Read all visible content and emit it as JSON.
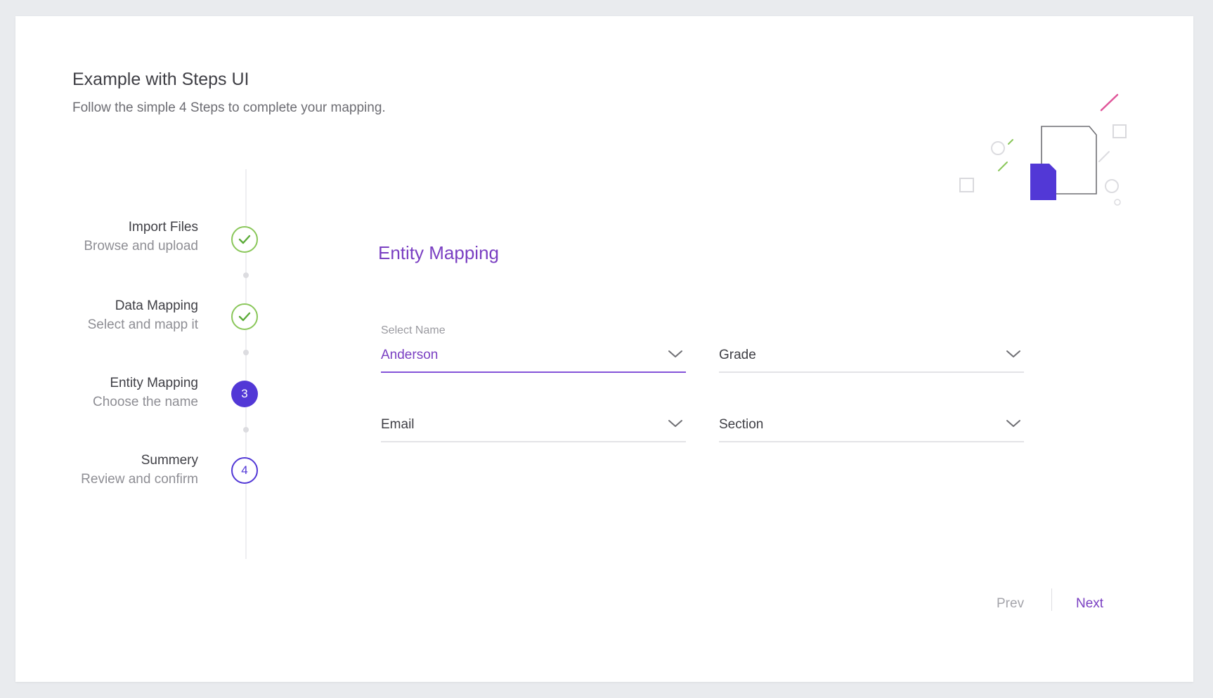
{
  "page": {
    "title": "Example with Steps UI",
    "subtitle": "Follow the simple 4 Steps to complete your mapping."
  },
  "steps": [
    {
      "title": "Import Files",
      "desc": "Browse and upload",
      "state": "done"
    },
    {
      "title": "Data Mapping",
      "desc": "Select and mapp it",
      "state": "done"
    },
    {
      "title": "Entity Mapping",
      "desc": "Choose the name",
      "state": "active",
      "number": "3"
    },
    {
      "title": "Summery",
      "desc": "Review and confirm",
      "state": "pending",
      "number": "4"
    }
  ],
  "form": {
    "title": "Entity Mapping",
    "fields": [
      {
        "label": "Select Name",
        "value": "Anderson"
      },
      {
        "label": "",
        "value": "Grade"
      },
      {
        "label": "",
        "value": "Email"
      },
      {
        "label": "",
        "value": "Section"
      }
    ]
  },
  "footer": {
    "prev_label": "Prev",
    "next_label": "Next"
  },
  "colors": {
    "accent": "#7a3fc2",
    "step_active": "#5238d6",
    "step_done": "#8ac75a"
  },
  "icons": {
    "done": "check-icon",
    "dropdown": "chevron-down-icon"
  }
}
